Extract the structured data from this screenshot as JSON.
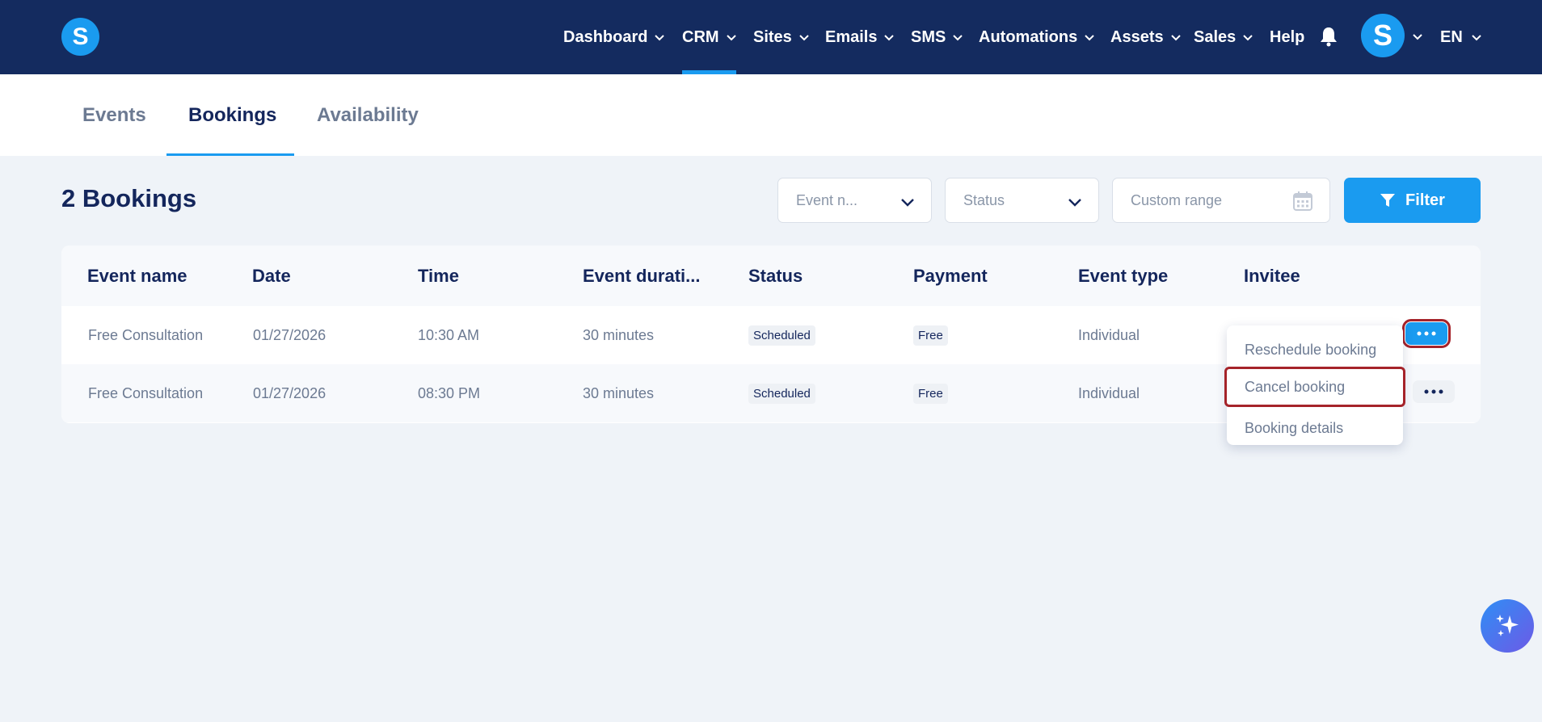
{
  "brand": {
    "logo_letter": "S"
  },
  "nav": {
    "items": [
      {
        "label": "Dashboard"
      },
      {
        "label": "CRM"
      },
      {
        "label": "Sites"
      },
      {
        "label": "Emails"
      },
      {
        "label": "SMS"
      },
      {
        "label": "Automations"
      },
      {
        "label": "Assets"
      },
      {
        "label": "Sales"
      },
      {
        "label": "Help"
      }
    ],
    "active": "CRM",
    "avatar_letter": "S",
    "language": "EN"
  },
  "subtabs": {
    "items": [
      {
        "label": "Events"
      },
      {
        "label": "Bookings"
      },
      {
        "label": "Availability"
      }
    ],
    "active": "Bookings"
  },
  "toolbar": {
    "title": "2 Bookings",
    "event_name_placeholder": "Event n...",
    "status_placeholder": "Status",
    "custom_range_placeholder": "Custom range",
    "filter_label": "Filter"
  },
  "table": {
    "columns": [
      "Event name",
      "Date",
      "Time",
      "Event durati...",
      "Status",
      "Payment",
      "Event type",
      "Invitee"
    ],
    "rows": [
      {
        "event_name": "Free Consultation",
        "date": "01/27/2026",
        "time": "10:30 AM",
        "duration": "30 minutes",
        "status": "Scheduled",
        "payment": "Free",
        "event_type": "Individual"
      },
      {
        "event_name": "Free Consultation",
        "date": "01/27/2026",
        "time": "08:30 PM",
        "duration": "30 minutes",
        "status": "Scheduled",
        "payment": "Free",
        "event_type": "Individual"
      }
    ]
  },
  "row_menu": {
    "items": [
      {
        "label": "Reschedule booking"
      },
      {
        "label": "Cancel booking"
      },
      {
        "label": "Booking details"
      }
    ],
    "highlighted": "Cancel booking"
  },
  "colors": {
    "nav_bg": "#142b5f",
    "accent": "#1a9bf0",
    "highlight_border": "#a5232a",
    "page_bg": "#eff3f8"
  },
  "icons": [
    "chevron-down-icon",
    "bell-icon",
    "calendar-icon",
    "filter-icon",
    "more-dots-icon",
    "sparkle-icon"
  ]
}
